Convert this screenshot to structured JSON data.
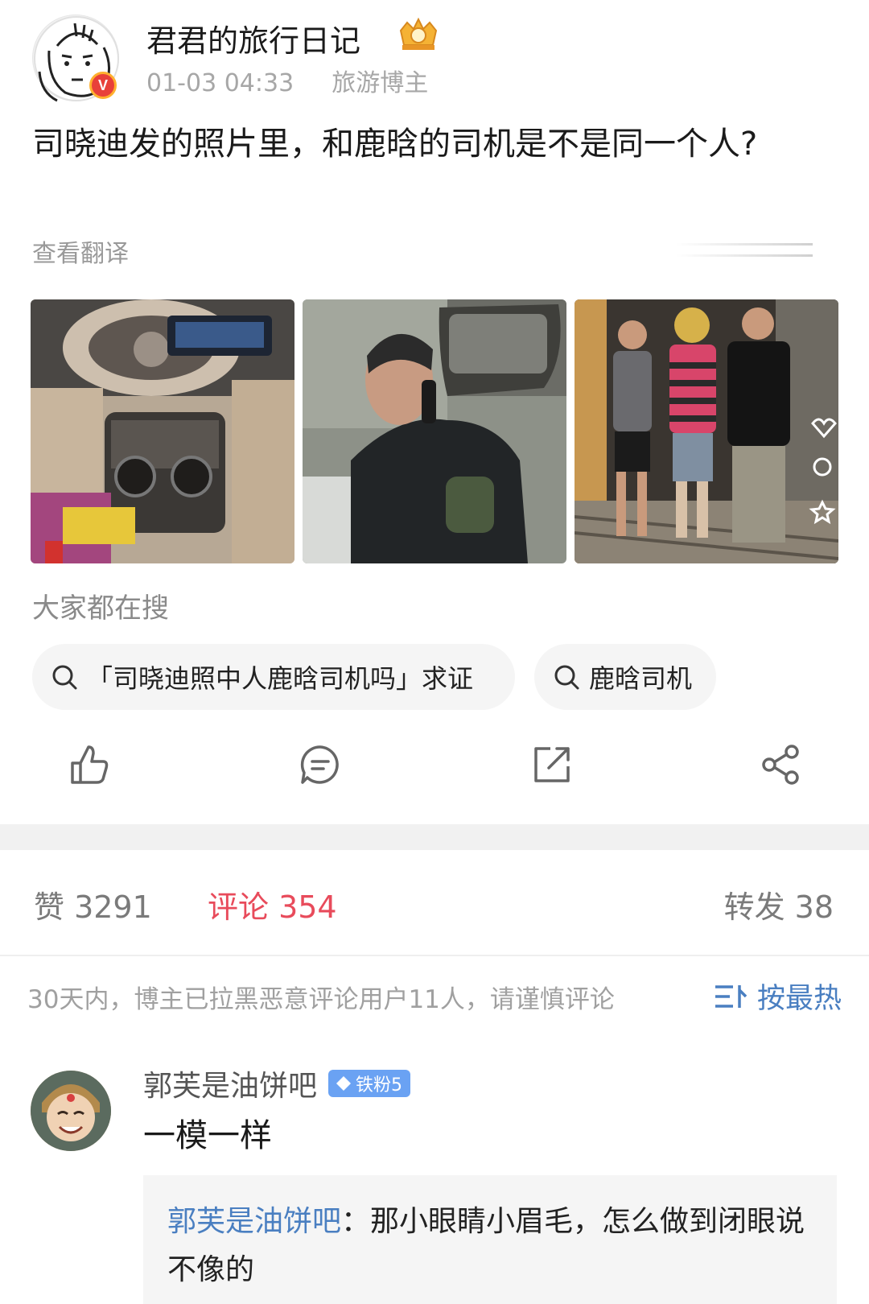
{
  "post": {
    "author": "君君的旅行日记",
    "date": "01-03 04:33",
    "role": "旅游博主",
    "text": "司晓迪发的照片里，和鹿晗的司机是不是同一个人?",
    "translate_label": "查看翻译"
  },
  "search": {
    "title": "大家都在搜",
    "chips": [
      "「司晓迪照中人鹿晗司机吗」求证",
      "鹿晗司机"
    ]
  },
  "actions": [
    "like-icon",
    "comment-icon",
    "repost-icon",
    "share-icon"
  ],
  "stats": {
    "likes": "赞 3291",
    "comments": "评论 354",
    "reposts": "转发 38"
  },
  "notice": "30天内，博主已拉黑恶意评论用户11人，请谨慎评论",
  "sort_label": "按最热",
  "comment": {
    "user": "郭芙是油饼吧",
    "badge": "铁粉5",
    "text": "一模一样",
    "reply_user": "郭芙是油饼吧",
    "reply_text": "：那小眼睛小眉毛，怎么做到闭眼说不像的"
  },
  "colors": {
    "accent_red": "#e84b5b",
    "link_blue": "#4a7fc1",
    "badge_blue": "#6aa2f3",
    "muted": "#a0a0a0"
  }
}
